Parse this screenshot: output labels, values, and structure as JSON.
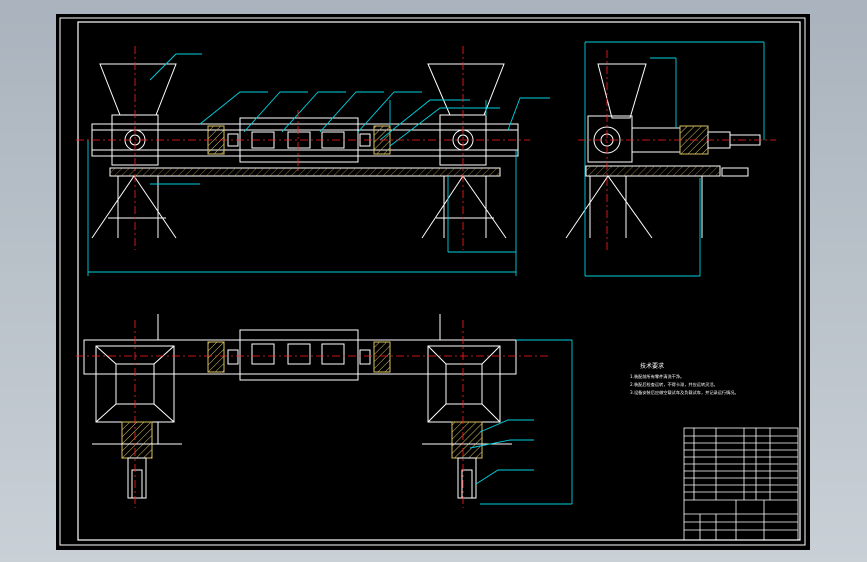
{
  "drawing": {
    "background": "#000000",
    "window_bg": "#b4bcc5",
    "colors": {
      "outline": "#ffffff",
      "dimension": "#00d0e0",
      "centerline": "#ff2020",
      "hatch": "#d8c060"
    },
    "technical_requirements": {
      "title": "技术要求",
      "lines": [
        "1.装配前所有零件清洗干净。",
        "2.装配后检查运转，不得卡滞，并应运转灵活。",
        "3.设备安装后应做空载试车及负载试车，并记录运行情况。"
      ]
    },
    "title_block": {
      "drawing_name": "",
      "parts_rows": 10
    }
  }
}
